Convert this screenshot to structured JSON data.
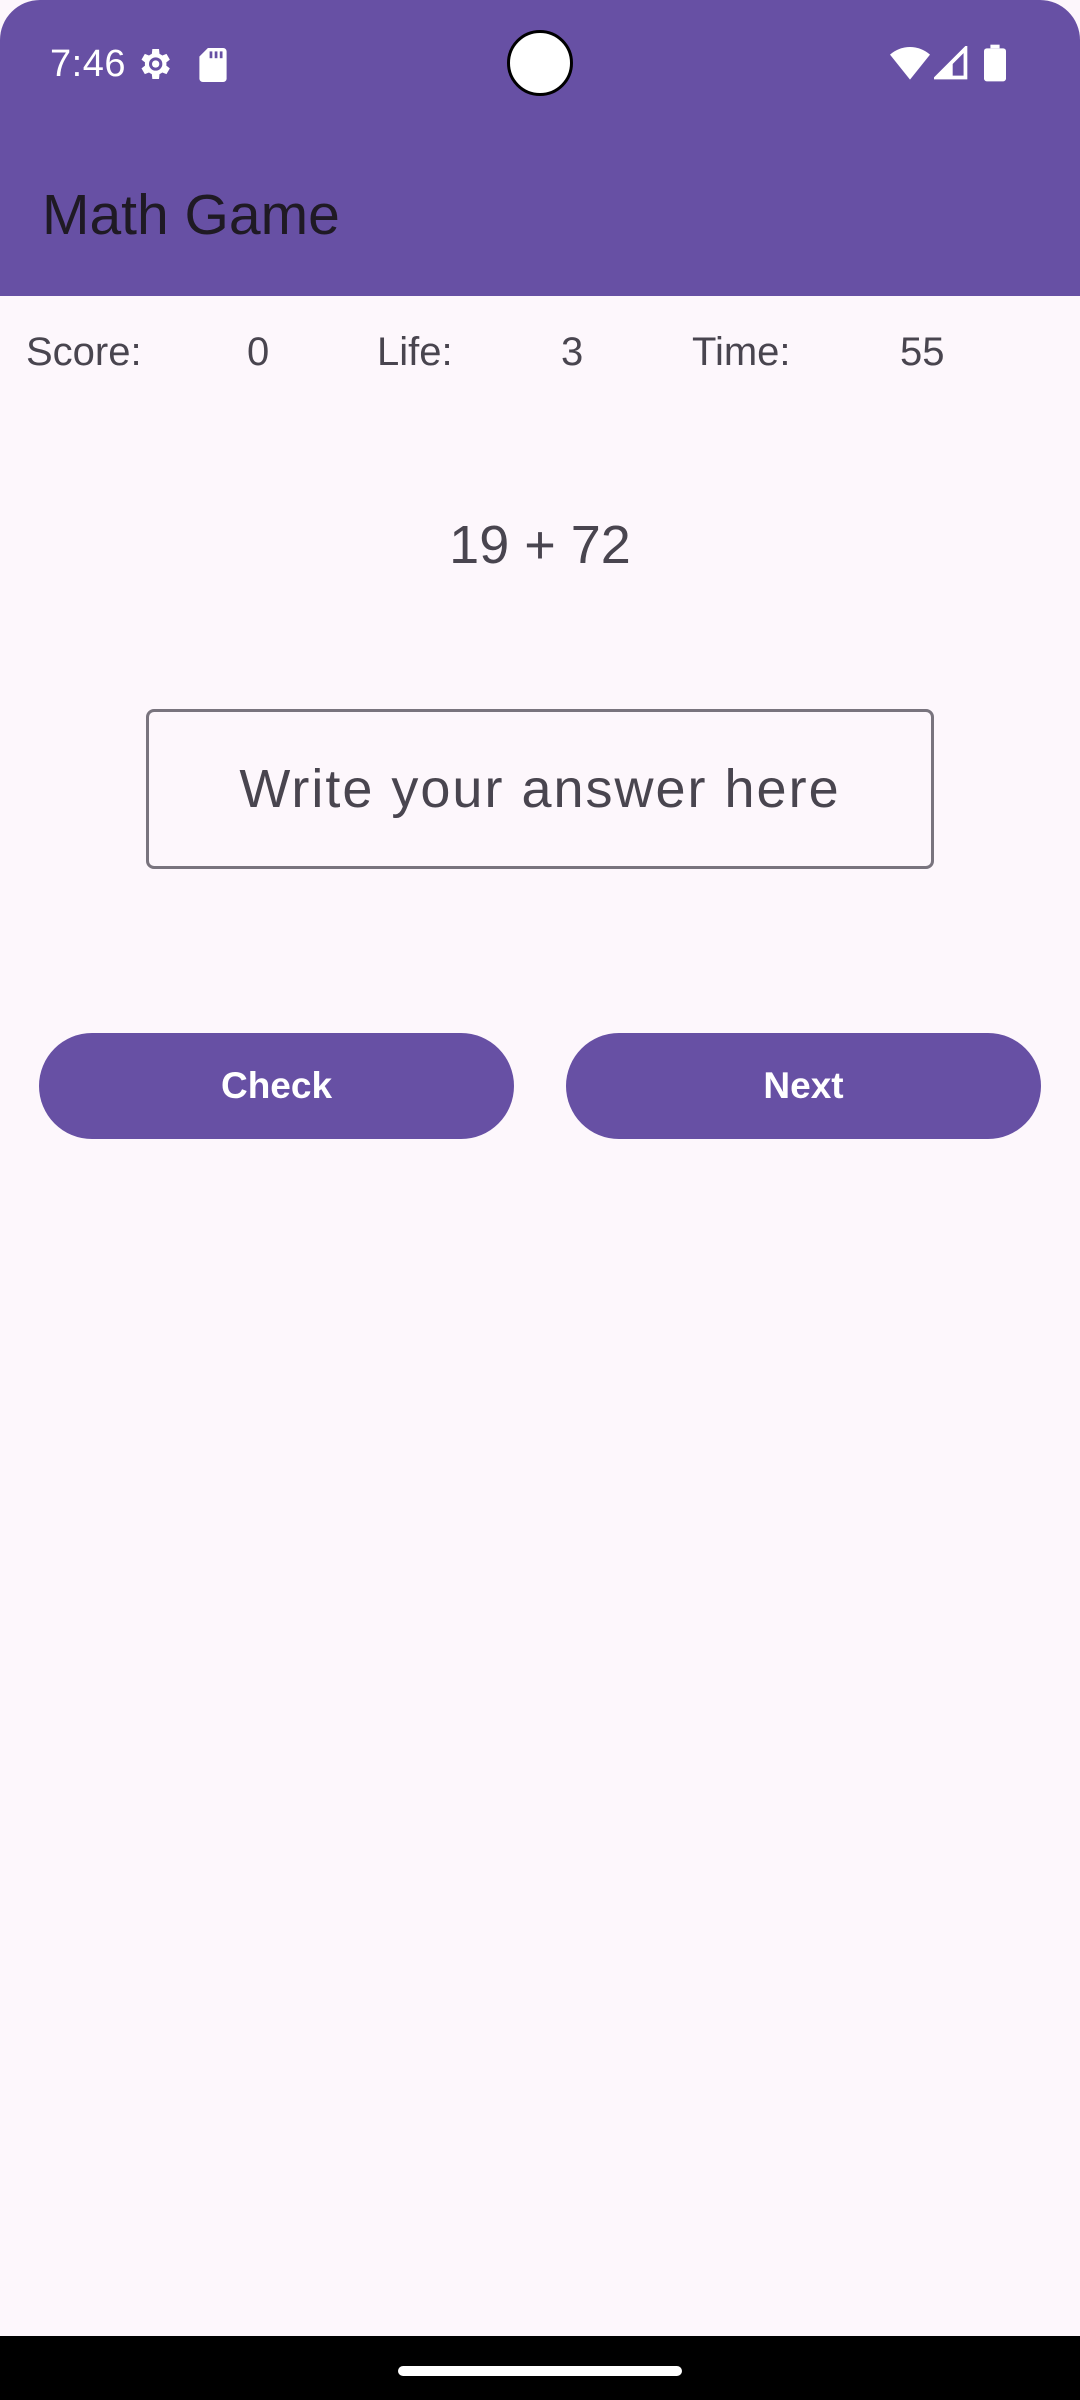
{
  "status_bar": {
    "time": "7:46",
    "icons": [
      "gear-icon",
      "sdcard-icon",
      "wifi-icon",
      "signal-icon",
      "battery-icon"
    ]
  },
  "app_bar": {
    "title": "Math Game"
  },
  "stats": {
    "score_label": "Score:",
    "score_value": "0",
    "life_label": "Life:",
    "life_value": "3",
    "time_label": "Time:",
    "time_value": "55"
  },
  "question": "19 + 72",
  "answer_input": {
    "value": "",
    "placeholder": "Write your answer here"
  },
  "buttons": {
    "check_label": "Check",
    "next_label": "Next"
  },
  "colors": {
    "primary": "#6750a4",
    "background": "#fdf7fc",
    "text": "#49454f"
  }
}
